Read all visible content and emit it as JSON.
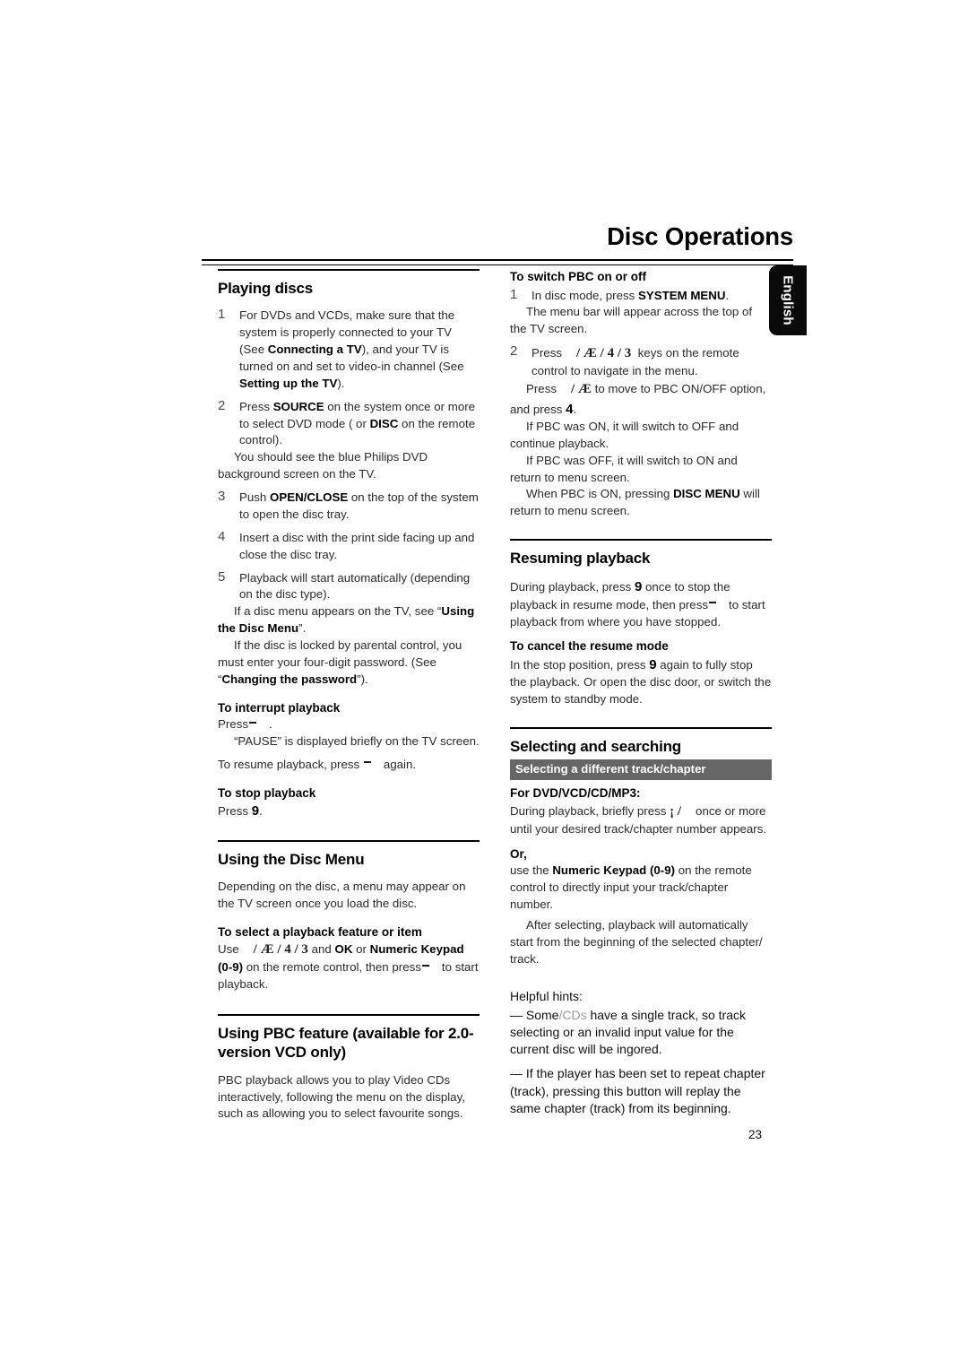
{
  "document": {
    "title": "Disc Operations",
    "language_tab": "English",
    "page_number": "23"
  },
  "left_column": {
    "playing_discs": {
      "heading": "Playing discs",
      "steps": [
        {
          "number": "1",
          "text_1": "For DVDs and VCDs, make sure that the system is properly connected to your TV (See ",
          "bold_1": "Connecting a TV",
          "text_2": "), and your TV is turned on and set to video-in channel (See ",
          "bold_2": "Setting up the TV",
          "text_3": ")."
        },
        {
          "number": "2",
          "text_1": "Press ",
          "bold_1": "SOURCE",
          "text_2": " on the system once or more to select DVD mode ( or ",
          "bold_2": "DISC",
          "text_3": " on the remote control).",
          "continuation": "You should see the blue Philips DVD background screen on the TV."
        },
        {
          "number": "3",
          "text_1": "Push ",
          "bold_1": "OPEN/CLOSE",
          "text_2": " on the top of the system to open the disc tray."
        },
        {
          "number": "4",
          "text_1": "Insert a disc with the print side facing up and close the disc tray."
        },
        {
          "number": "5",
          "text_1": "Playback will start automatically (depending on the disc type).",
          "continuation_1_a": "If a disc menu appears on the TV, see “",
          "continuation_1_bold": "Using the Disc Menu",
          "continuation_1_b": "”.",
          "continuation_2_a": "If the disc is locked by parental control, you must enter your four-digit password. (See “",
          "continuation_2_bold": "Changing the password",
          "continuation_2_b": "”)."
        }
      ],
      "interrupt": {
        "heading": "To interrupt playback",
        "press_label": "Press",
        "press_suffix": ".",
        "note": "“PAUSE” is displayed briefly on the TV screen.",
        "resume_prefix": "To resume playback, press",
        "resume_suffix": "again."
      },
      "stop": {
        "heading": "To stop playback",
        "press_label": "Press",
        "key": "9",
        "period": "."
      }
    },
    "disc_menu": {
      "heading": "Using the Disc Menu",
      "intro": "Depending on the disc, a menu may appear on the TV screen once you load the disc.",
      "select_feature": {
        "heading": "To select a playback feature or item",
        "use_label": "Use",
        "keys": "/ Æ  / 4  / 3",
        "mid_1": " and ",
        "bold_1": "OK",
        "mid_2": " or ",
        "bold_2": "Numeric Keypad (0-9)",
        "mid_3": " on the remote control, then press",
        "tail": "to start playback."
      }
    },
    "pbc": {
      "heading": "Using PBC feature (available for 2.0-version VCD only)",
      "body": "PBC playback allows you to play Video CDs interactively, following the menu on the display, such as allowing you to select favourite songs."
    }
  },
  "right_column": {
    "pbc_switch": {
      "heading": "To switch PBC on or off",
      "steps": [
        {
          "number": "1",
          "text_1": "In disc mode, press ",
          "bold_1": "SYSTEM MENU",
          "text_2": ".",
          "continuation": "The menu bar will appear across the top of the TV screen."
        },
        {
          "number": "2",
          "text_1": "Press",
          "keys": "/ Æ  / 4  / 3",
          "text_2": "keys on the remote control to navigate in the menu.",
          "continuation_1_a": "Press",
          "continuation_1_keys": "/ Æ",
          "continuation_1_b": "to move to PBC ON/OFF option, and press",
          "continuation_1_key2": "4",
          "continuation_1_c": ".",
          "continuation_2": "If PBC was ON, it will switch to OFF and continue playback.",
          "continuation_3": "If PBC was OFF, it will switch to ON and return to menu screen.",
          "continuation_4_a": "When PBC is ON, pressing ",
          "continuation_4_bold": "DISC MENU",
          "continuation_4_b": " will return to menu screen."
        }
      ]
    },
    "resuming": {
      "heading": "Resuming playback",
      "body_1": "During playback, press",
      "body_key": "9",
      "body_2": "once to stop the playback in resume mode, then press",
      "body_3": "to start playback from where you have stopped.",
      "cancel": {
        "heading": "To cancel the resume mode",
        "text_1": "In the stop position, press",
        "key": "9",
        "text_2": "again to fully stop the playback. Or open the disc door, or switch the system to standby mode."
      }
    },
    "selecting": {
      "heading": "Selecting and searching",
      "banner": "Selecting a different track/chapter",
      "for_label": "For DVD/VCD/CD/MP3:",
      "body_1": "During playback, briefly press",
      "keys": "¡  /",
      "body_2": "once or more until your desired track/chapter number appears.",
      "or_label": "Or,",
      "or_1": "use the ",
      "or_bold": "Numeric Keypad (0-9)",
      "or_2": " on the remote control to directly input your track/chapter number.",
      "or_cont": "After selecting, playback will automatically start from the beginning of the selected chapter/ track."
    },
    "hints": {
      "heading": "Helpful hints:",
      "hint_1_a": "— Some",
      "hint_1_dim": "/CDs",
      "hint_1_b": " have a single track,  so track selecting or an invalid input value for the current disc will be ingored.",
      "hint_2": "—  If the player has been set to repeat chapter (track), pressing this button will replay the same chapter (track) from its beginning."
    }
  },
  "colors": {
    "banner_bg": "#666666",
    "tab_bg": "#0a0a0a",
    "body_text": "#2b2b2b",
    "dim_text": "#9a9a9a"
  }
}
